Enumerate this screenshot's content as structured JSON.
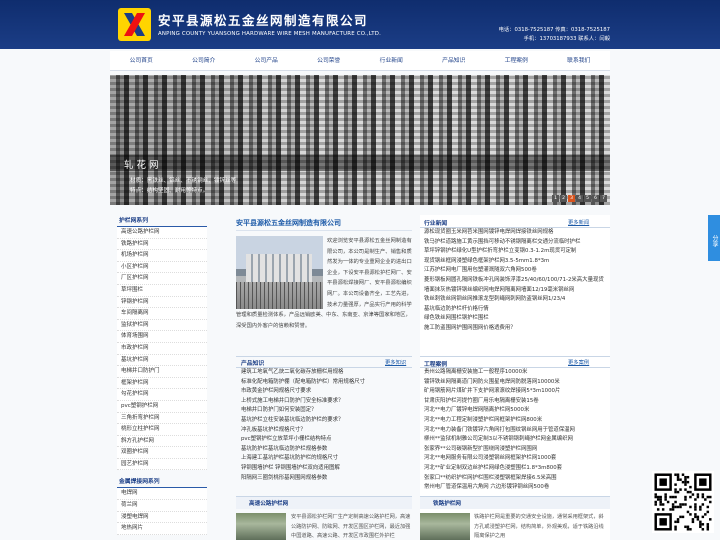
{
  "header": {
    "company_cn": "安平县源松五金丝网制造有限公司",
    "company_en": "ANPING COUNTY YUANSONG HARDWARE WIRE MESH MANUFACTURE CO.,LTD.",
    "contact_line1": "电话：0318-7525187 传真：0318-7525187",
    "contact_line2": "手机：13703187933  联系人：闫毅"
  },
  "nav": [
    "公司首页",
    "公司简介",
    "公司产品",
    "公司荣誉",
    "行业新闻",
    "产品知识",
    "工程案例",
    "联系我们"
  ],
  "banner": {
    "title": "轧花网",
    "desc_line1": "材质：黑铁丝、铝丝、不锈钢丝、镀锌丝等",
    "desc_line2": "特点：结构坚固、耐用等特点。",
    "pages": [
      "1",
      "2",
      "3",
      "4",
      "5",
      "6",
      "7"
    ],
    "active_page": "3"
  },
  "sidebar": {
    "title1": "护栏网系列",
    "items1": [
      "高速公路护栏网",
      "铁路护栏网",
      "机场护栏网",
      "小区护栏网",
      "厂区护栏网",
      "草坪围栏",
      "锌钢护栏网",
      "车间隔离网",
      "监狱护栏网",
      "体育场围网",
      "市政护栏网",
      "基坑护栏网",
      "电梯井口防护门",
      "框架护栏网",
      "勾花护栏网",
      "pvc塑钢护栏网",
      "三角折弯护栏网",
      "桃形立柱护栏网",
      "斜方孔护栏网",
      "双圈护栏网",
      "园艺护栏网"
    ],
    "title2": "金属焊接网系列",
    "items2": [
      "电焊网",
      "荷兰网",
      "浸塑电焊网",
      "地热网片"
    ]
  },
  "intro": {
    "title": "安平县源松五金丝网制造有限公司",
    "text": "欢迎浏览安平县源松五金丝网制造有限公司，本公司是制生产、销售和质然发为一体的专业重网企业的进出口企业，下设安平县源松护栏网厂、安平县源松焊接网厂、安平县源松编织网厂。本公司设备齐全，工艺先进，技术力量强厚，产品实行产用的科学管理和质量检测体系，产品远销欧美、中东、东南亚、京津等国家和地区，深受国内外客户的信赖和赞誉。"
  },
  "knowledge": {
    "title": "产品知识",
    "more": "更多知识",
    "items": [
      "建筑工地氧气乙炔二氧化碳存放栅栏用规格",
      "标准化配电箱防护棚（配电箱防护栏）常用规格尺寸",
      "市政黄金护栏网规格尺寸要求",
      "上桥式施工电梯井口防护门安全标准要求？",
      "电梯井口防护门如何安装固定？",
      "基坑护栏立柱安装基坑临边防护栏的要求？",
      "冲孔板基坑护栏规格尺寸？",
      "pvc塑钢护栏立放草坪小栅栏结构特点",
      "基坑防护栏基坑临边防护栏规格参数",
      "上海建工基坑护栏基坑防护栏的规格尺寸",
      "锌钢围墙护栏 锌钢围墙护栏双向适用图解",
      "阳隔网三圈剑桃形基网围网规格参数"
    ]
  },
  "industry": {
    "title": "行业新闻",
    "more": "更多新闻",
    "items": [
      "源松现货圈玉米网苕米围网镀锌电焊网焊接铁丝网规格",
      "铁马护栏道路施工黄示围挡可移动不锈钢隔离栏交通分流临时护栏",
      "草坪锌钢护栏绿化U型护栏折弯护栏立变钢0.3-1.2m现货可定制",
      "现货钢丝框网浸塑绿色框架护栏网3.5-5mm1.8*3m",
      "江苏护栏网电厂围用包塑灌溉隧双六角网500卷",
      "菱形钢板网圆孔隔网铁板冲孔网装饰浮漆25/40/60/100/71-2米高大量现货",
      "墙面抹灰热镀锌钢丝编织网电焊网隔离网墙面12/19毫米钢丝网",
      "铁丝刺铁丝网钢丝网推滚龙型刺绳网刺网防盗钢丝网1/23/4",
      "基坑临边防护栏杆价格行情",
      "绿色铁丝网围栏钢护栏围栏",
      "施工防盗围网护围网围网价格透费用？"
    ]
  },
  "cases": {
    "title": "工程案例",
    "more": "更多案例",
    "items": [
      "贵州公路隔离栅安装施工一般程序10000米",
      "镀锌铁丝网隔离道门网防火围星电焊网防脱落网10000米",
      "矿用钢筋网片煤矿井下支护网滚滚纹焊接网5*3m1000片",
      "甘肃庆阳护栏河提竹圈厂用乐电隔离栅安装15卷",
      "河北**电力厂镀锌电焊网隔离护栏网5000米",
      "河北**电力工程定制浸塑护栏网框架护栏网800米",
      "河北**电力装备门铁镀锌六角网打包围纹钢丝网用于管道保温网",
      "柳州**监狱机制雅公司定制3以不锈钢钢刺绳护栏网金属编织网",
      "张家界**公司碳钢新型扩围绕网浸塑护栏网围网",
      "河北**电网服务有限公司浸塑钢丝网框架护栏网1000套",
      "河北**矿业定制双边丝护栏网绿色浸塑围栏1.8*3m800套",
      "张家口**纺织护栏网护栏围栏浸塑钢框架焊接6.5米高围",
      "常州电厂管道保温用六角网 六边形镀锌钢丝网500卷"
    ]
  },
  "blocks": {
    "highway_title": "高速公路护栏网",
    "highway_text": "安平县源松护栏网厂生产定制高速公路护栏网，高速公路防护网、防眩网、开发区围区护栏网，最近加强中国道路、高速公路、开发区市政围栏外护栏",
    "railway_title": "铁路护栏网",
    "railway_text": "铁路护栏网是重要的交通安全设施，通常采用框架式，斜方孔或浸塑护栏网，结构简单，外观美观，适于铁路沿线隔离保护之用"
  },
  "share": "分享"
}
